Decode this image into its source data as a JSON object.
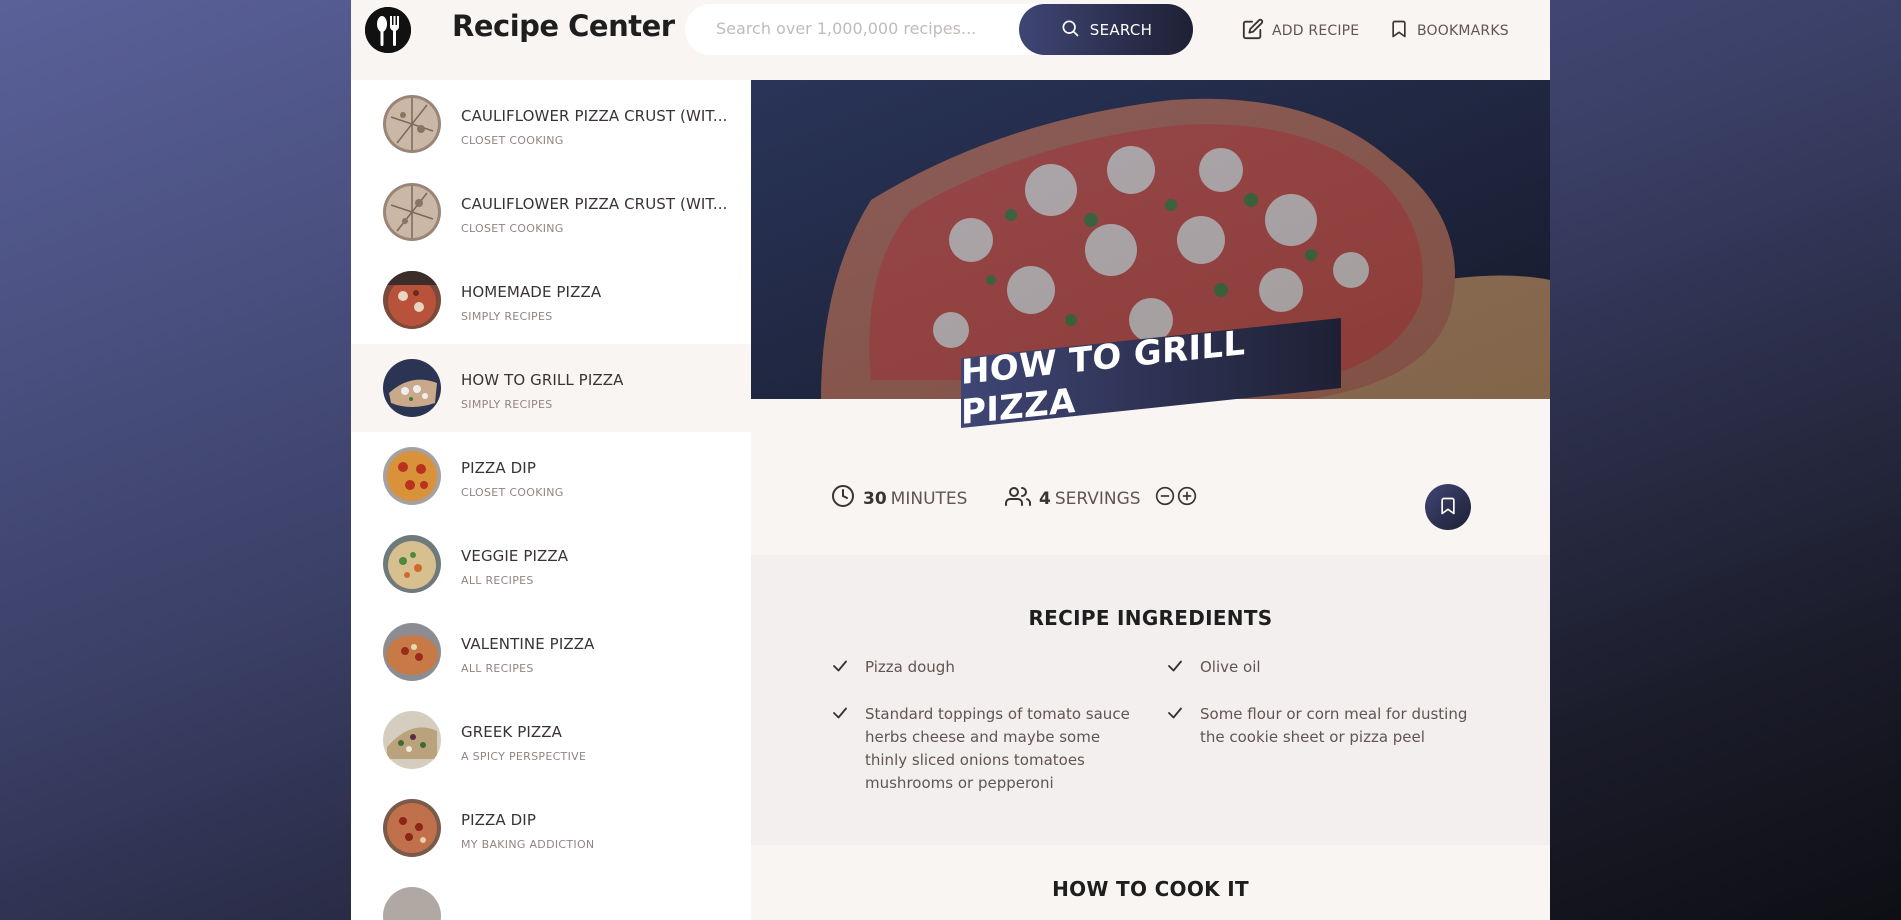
{
  "header": {
    "brand": "Recipe Center",
    "search_placeholder": "Search over 1,000,000 recipes...",
    "search_label": "SEARCH",
    "add_recipe_label": "ADD RECIPE",
    "bookmarks_label": "BOOKMARKS"
  },
  "results": [
    {
      "title": "CAULIFLOWER PIZZA CRUST (WIT...",
      "publisher": "CLOSET COOKING",
      "active": false
    },
    {
      "title": "CAULIFLOWER PIZZA CRUST (WIT...",
      "publisher": "CLOSET COOKING",
      "active": false
    },
    {
      "title": "HOMEMADE PIZZA",
      "publisher": "SIMPLY RECIPES",
      "active": false
    },
    {
      "title": "HOW TO GRILL PIZZA",
      "publisher": "SIMPLY RECIPES",
      "active": true
    },
    {
      "title": "PIZZA DIP",
      "publisher": "CLOSET COOKING",
      "active": false
    },
    {
      "title": "VEGGIE PIZZA",
      "publisher": "ALL RECIPES",
      "active": false
    },
    {
      "title": "VALENTINE PIZZA",
      "publisher": "ALL RECIPES",
      "active": false
    },
    {
      "title": "GREEK PIZZA",
      "publisher": "A SPICY PERSPECTIVE",
      "active": false
    },
    {
      "title": "PIZZA DIP",
      "publisher": "MY BAKING ADDICTION",
      "active": false
    }
  ],
  "recipe": {
    "title": "HOW TO GRILL PIZZA",
    "minutes_value": "30",
    "minutes_unit": "MINUTES",
    "servings_value": "4",
    "servings_unit": "SERVINGS",
    "ingredients_heading": "RECIPE INGREDIENTS",
    "ingredients": [
      "Pizza dough",
      "Olive oil",
      "Standard toppings of tomato sauce herbs cheese and maybe some thinly sliced onions tomatoes mushrooms or pepperoni",
      "Some flour or corn meal for dusting the cookie sheet or pizza peel"
    ],
    "directions_heading": "HOW TO COOK IT"
  },
  "colors": {
    "accent_dark": "#1e2034",
    "accent_light": "#3f4675",
    "panel": "#f9f5f3",
    "ingredients_bg": "#f2efee"
  },
  "icons": [
    "logo-icon",
    "search-icon",
    "edit-icon",
    "bookmark-icon",
    "clock-icon",
    "users-icon",
    "minus-circle-icon",
    "plus-circle-icon",
    "check-icon"
  ]
}
